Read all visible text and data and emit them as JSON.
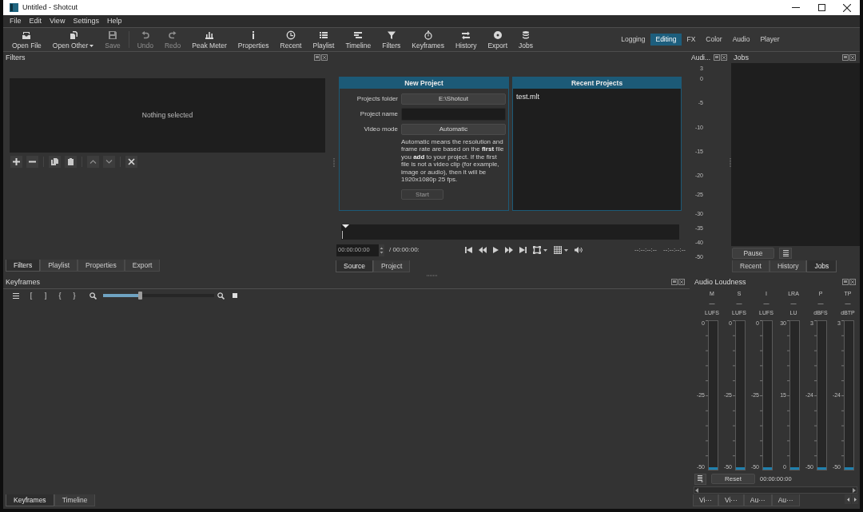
{
  "window": {
    "title": "Untitled - Shotcut"
  },
  "menu": [
    "File",
    "Edit",
    "View",
    "Settings",
    "Help"
  ],
  "toolbar": [
    {
      "label": "Open File",
      "kind": "button",
      "disabled": false
    },
    {
      "label": "Open Other",
      "kind": "menu",
      "disabled": false
    },
    {
      "label": "Save",
      "kind": "button",
      "disabled": true
    },
    {
      "label": "Undo",
      "kind": "button",
      "disabled": true
    },
    {
      "label": "Redo",
      "kind": "button",
      "disabled": true
    },
    {
      "label": "Peak Meter",
      "kind": "button",
      "disabled": false
    },
    {
      "label": "Properties",
      "kind": "button",
      "disabled": false
    },
    {
      "label": "Recent",
      "kind": "button",
      "disabled": false
    },
    {
      "label": "Playlist",
      "kind": "button",
      "disabled": false
    },
    {
      "label": "Timeline",
      "kind": "button",
      "disabled": false
    },
    {
      "label": "Filters",
      "kind": "button",
      "disabled": false
    },
    {
      "label": "Keyframes",
      "kind": "button",
      "disabled": false
    },
    {
      "label": "History",
      "kind": "button",
      "disabled": false
    },
    {
      "label": "Export",
      "kind": "button",
      "disabled": false
    },
    {
      "label": "Jobs",
      "kind": "button",
      "disabled": false
    }
  ],
  "layouts": [
    {
      "label": "Logging",
      "selected": false
    },
    {
      "label": "Editing",
      "selected": true
    },
    {
      "label": "FX",
      "selected": false
    },
    {
      "label": "Color",
      "selected": false
    },
    {
      "label": "Audio",
      "selected": false
    },
    {
      "label": "Player",
      "selected": false
    }
  ],
  "filters": {
    "title": "Filters",
    "message": "Nothing selected",
    "tabs": [
      {
        "label": "Filters",
        "selected": true
      },
      {
        "label": "Playlist",
        "selected": false
      },
      {
        "label": "Properties",
        "selected": false
      },
      {
        "label": "Export",
        "selected": false
      }
    ]
  },
  "new_project": {
    "title": "New Project",
    "fields": [
      {
        "label": "Projects folder",
        "kind": "button",
        "value": "E:\\Shotcut"
      },
      {
        "label": "Project name",
        "kind": "input"
      },
      {
        "label": "Video mode",
        "kind": "button",
        "value": "Automatic"
      }
    ],
    "description": "Automatic means the resolution and frame rate are based on the **first** file you **add** to your project. If the first file is not a video clip (for example, image or audio), then it will be 1920x1080p 25 fps.",
    "start_button": {
      "label": "Start",
      "disabled": true
    }
  },
  "recent_projects": {
    "title": "Recent Projects",
    "items": [
      "test.mlt"
    ]
  },
  "player": {
    "timecode": "00:00:00:00",
    "duration": "/ 00:00:00:",
    "in_point": "--:--:--:--",
    "out_point": "--:--:--:--",
    "tabs": [
      {
        "label": "Source",
        "selected": true
      },
      {
        "label": "Project",
        "selected": false
      }
    ]
  },
  "audio_meter": {
    "title": "Audi...",
    "scale": [
      "3",
      "0",
      "-5",
      "-10",
      "-15",
      "-20",
      "-25",
      "-30",
      "-35",
      "-40",
      "-50"
    ]
  },
  "jobs": {
    "title": "Jobs",
    "pause_button": "Pause",
    "tabs": [
      {
        "label": "Recent",
        "selected": false
      },
      {
        "label": "History",
        "selected": false
      },
      {
        "label": "Jobs",
        "selected": true
      }
    ]
  },
  "keyframes": {
    "title": "Keyframes",
    "tool_buttons": [
      "[",
      "]",
      "{",
      "}"
    ],
    "zoom_slider": {
      "level": 0.33
    },
    "tabs": [
      {
        "label": "Keyframes",
        "selected": true
      },
      {
        "label": "Timeline",
        "selected": false
      }
    ]
  },
  "loudness": {
    "title": "Audio Loudness",
    "meters": [
      {
        "label": "M",
        "reading": "—",
        "unit": "LUFS",
        "scale": [
          "0",
          "-25",
          "-50"
        ],
        "level": 0.015
      },
      {
        "label": "S",
        "reading": "—",
        "unit": "LUFS",
        "scale": [
          "0",
          "-25",
          "-50"
        ],
        "level": 0.015
      },
      {
        "label": "I",
        "reading": "—",
        "unit": "LUFS",
        "scale": [
          "0",
          "-25",
          "-50"
        ],
        "level": 0.015
      },
      {
        "label": "LRA",
        "reading": "—",
        "unit": "LU",
        "scale": [
          "30",
          "15",
          "0"
        ],
        "level": 0.015
      },
      {
        "label": "P",
        "reading": "—",
        "unit": "dBFS",
        "scale": [
          "3",
          "-24",
          "-50"
        ],
        "level": 0.015
      },
      {
        "label": "TP",
        "reading": "—",
        "unit": "dBTP",
        "scale": [
          "3",
          "-24",
          "-50"
        ],
        "level": 0.015
      }
    ],
    "reset_button": "Reset",
    "time": "00:00:00:00",
    "tabs": [
      {
        "label": "Vi···",
        "selected": false
      },
      {
        "label": "Vi···",
        "selected": false
      },
      {
        "label": "Au···",
        "selected": false
      },
      {
        "label": "Au···",
        "selected": false
      }
    ]
  }
}
